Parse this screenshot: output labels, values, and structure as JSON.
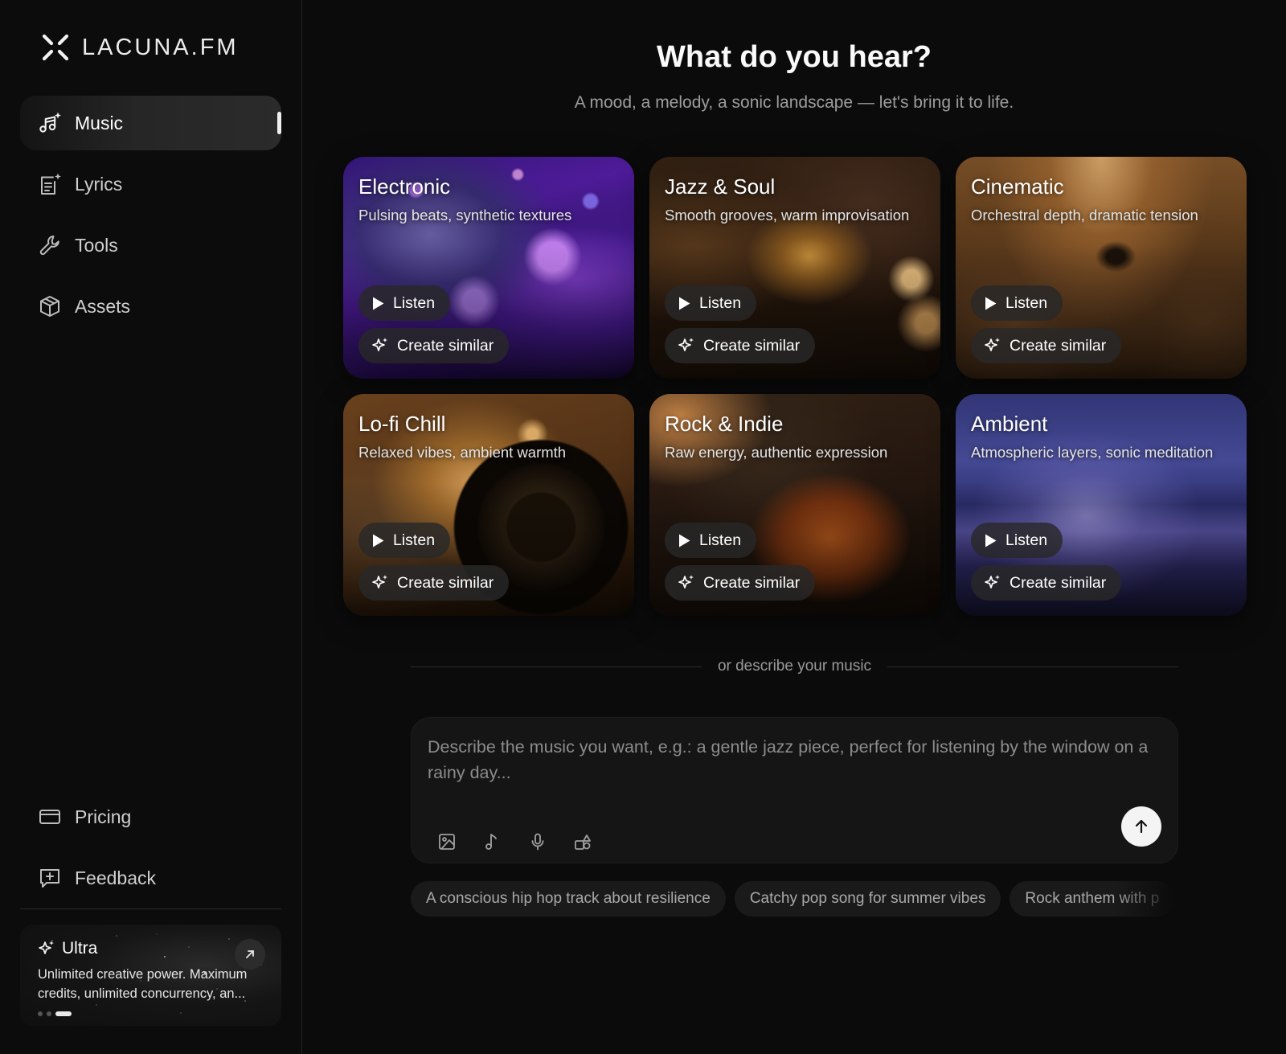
{
  "app": {
    "brand": "LACUNA.FM"
  },
  "sidebar": {
    "items": [
      {
        "id": "music",
        "label": "Music",
        "icon": "music-sparkle-icon",
        "active": true
      },
      {
        "id": "lyrics",
        "label": "Lyrics",
        "icon": "lyrics-sparkle-icon",
        "active": false
      },
      {
        "id": "tools",
        "label": "Tools",
        "icon": "wrench-icon",
        "active": false
      },
      {
        "id": "assets",
        "label": "Assets",
        "icon": "box-icon",
        "active": false
      }
    ],
    "bottom_items": [
      {
        "id": "pricing",
        "label": "Pricing",
        "icon": "credit-card-icon"
      },
      {
        "id": "feedback",
        "label": "Feedback",
        "icon": "feedback-icon"
      }
    ],
    "promo": {
      "title": "Ultra",
      "description": "Unlimited creative power. Maximum credits, unlimited concurrency, an...",
      "carousel_dots": 3,
      "active_dot": 3
    }
  },
  "main": {
    "title": "What do you hear?",
    "subtitle": "A mood, a melody, a sonic landscape — let's bring it to life.",
    "listen_label": "Listen",
    "similar_label": "Create similar",
    "genres": [
      {
        "title": "Electronic",
        "subtitle": "Pulsing beats, synthetic textures"
      },
      {
        "title": "Jazz & Soul",
        "subtitle": "Smooth grooves, warm improvisation"
      },
      {
        "title": "Cinematic",
        "subtitle": "Orchestral depth, dramatic tension"
      },
      {
        "title": "Lo-fi Chill",
        "subtitle": "Relaxed vibes, ambient warmth"
      },
      {
        "title": "Rock & Indie",
        "subtitle": "Raw energy, authentic expression"
      },
      {
        "title": "Ambient",
        "subtitle": "Atmospheric layers, sonic meditation"
      }
    ],
    "divider_text": "or describe your music",
    "composer": {
      "placeholder": "Describe the music you want, e.g.: a gentle jazz piece, perfect for listening by the window on a rainy day...",
      "value": "",
      "tools": [
        "image-icon",
        "music-note-icon",
        "microphone-icon",
        "shapes-icon"
      ],
      "send_icon": "arrow-up-icon"
    },
    "suggestions": [
      "A conscious hip hop track about resilience",
      "Catchy pop song for summer vibes",
      "Rock anthem with p"
    ]
  },
  "colors": {
    "background": "#0b0b0b",
    "sidebar": "#0c0c0c",
    "card_pill": "#282828",
    "accent": "#f4f4f4"
  }
}
